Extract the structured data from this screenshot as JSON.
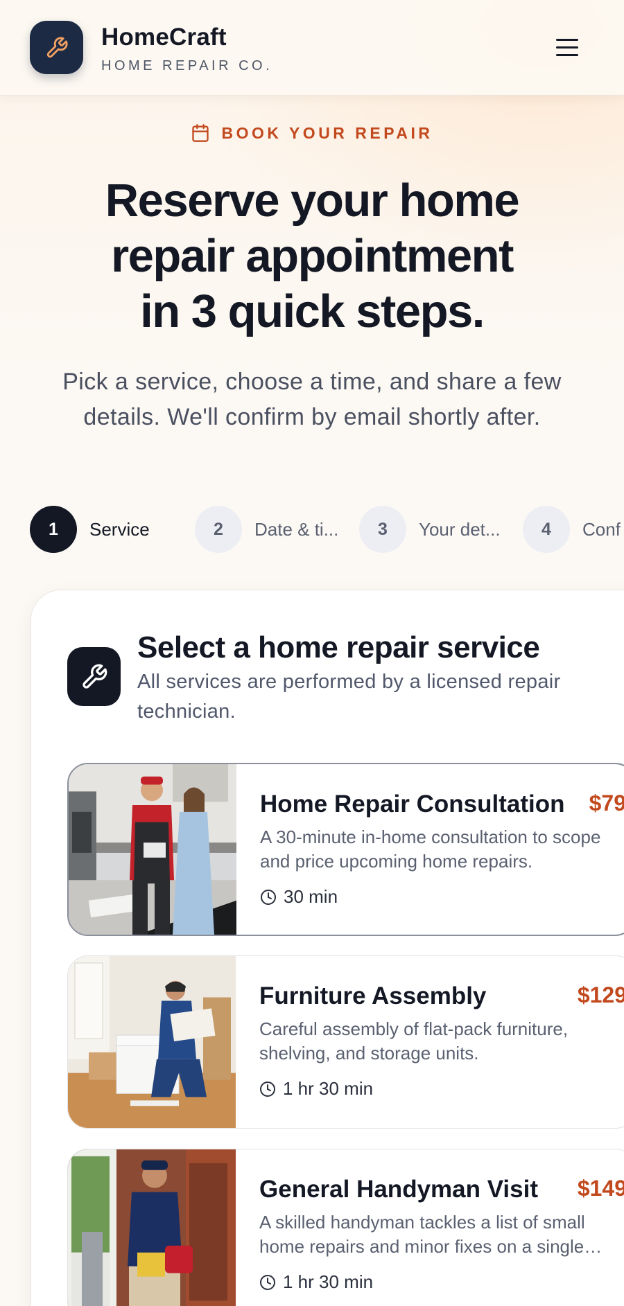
{
  "header": {
    "brand_name": "HomeCraft",
    "brand_sub": "HOME REPAIR CO.",
    "logo_icon": "wrench-icon",
    "menu_icon": "hamburger-menu-icon"
  },
  "hero": {
    "eyebrow": "BOOK YOUR REPAIR",
    "eyebrow_icon": "calendar-icon",
    "title_line1": "Reserve your home",
    "title_line2": "repair appointment",
    "title_line3": "in 3 quick steps.",
    "subtitle": "Pick a service, choose a time, and share a few details. We'll confirm by email shortly after."
  },
  "stepper": {
    "steps": [
      {
        "number": "1",
        "label": "Service",
        "state": "active"
      },
      {
        "number": "2",
        "label": "Date & ti...",
        "state": "upcoming"
      },
      {
        "number": "3",
        "label": "Your det...",
        "state": "upcoming"
      },
      {
        "number": "4",
        "label": "Conf",
        "state": "upcoming"
      }
    ]
  },
  "service_card": {
    "icon": "wrench-icon",
    "title": "Select a home repair service",
    "subtitle": "All services are performed by a licensed repair technician.",
    "services": [
      {
        "title": "Home Repair Consultation",
        "price": "$79",
        "description": "A 30-minute in-home consultation to scope and price upcoming home repairs.",
        "duration": "30 min",
        "image": "technician-consultation-photo",
        "selected": true
      },
      {
        "title": "Furniture Assembly",
        "price": "$129",
        "description": "Careful assembly of flat-pack furniture, shelving, and storage units.",
        "duration": "1 hr 30 min",
        "image": "furniture-assembly-photo",
        "selected": false
      },
      {
        "title": "General Handyman Visit",
        "price": "$149",
        "description": "A skilled handyman tackles a list of small home repairs and minor fixes on a single visit.",
        "duration": "1 hr 30 min",
        "image": "handyman-photo",
        "selected": false
      }
    ]
  },
  "colors": {
    "accent": "#c2491d",
    "dark": "#141824",
    "logo_bg": "#1d2a44"
  }
}
